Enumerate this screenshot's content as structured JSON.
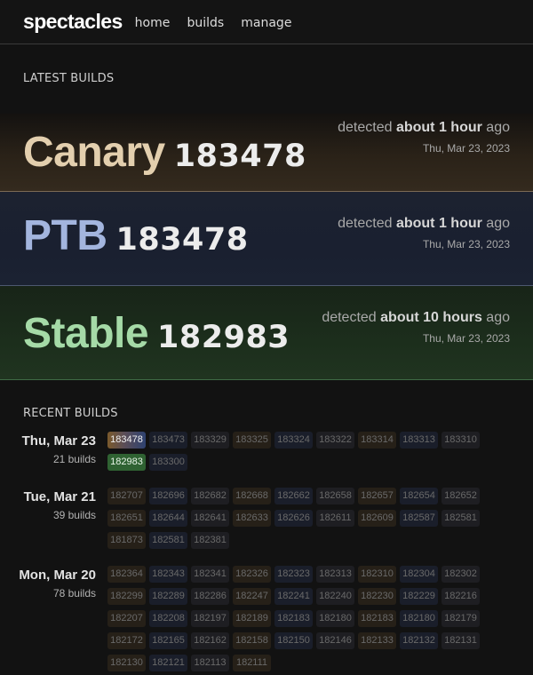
{
  "header": {
    "logo": "spectacles",
    "nav": [
      "home",
      "builds",
      "manage"
    ]
  },
  "latest": {
    "title": "LATEST BUILDS",
    "rows": [
      {
        "channel": "Canary",
        "build": "183478",
        "detected_prefix": "detected",
        "detected_strong": "about 1 hour",
        "detected_suffix": "ago",
        "date": "Thu, Mar 23, 2023",
        "color": "#e3cfae"
      },
      {
        "channel": "PTB",
        "build": "183478",
        "detected_prefix": "detected",
        "detected_strong": "about 1 hour",
        "detected_suffix": "ago",
        "date": "Thu, Mar 23, 2023",
        "color": "#a3b5de"
      },
      {
        "channel": "Stable",
        "build": "182983",
        "detected_prefix": "detected",
        "detected_strong": "about 10 hours",
        "detected_suffix": "ago",
        "date": "Thu, Mar 23, 2023",
        "color": "#a5daa7"
      }
    ]
  },
  "recent": {
    "title": "RECENT BUILDS",
    "groups": [
      {
        "date": "Thu, Mar 23",
        "count": "21 builds",
        "builds": [
          "183478",
          "183473",
          "183329",
          "183325",
          "183324",
          "183322",
          "183314",
          "183313",
          "183310",
          "182983",
          "183300"
        ]
      },
      {
        "date": "Tue, Mar 21",
        "count": "39 builds",
        "builds": [
          "182707",
          "182696",
          "182682",
          "182668",
          "182662",
          "182658",
          "182657",
          "182654",
          "182652",
          "182651",
          "182644",
          "182641",
          "182633",
          "182626",
          "182611",
          "182609",
          "182587",
          "182581",
          "181873",
          "182581",
          "182381"
        ]
      },
      {
        "date": "Mon, Mar 20",
        "count": "78 builds",
        "builds": [
          "182364",
          "182343",
          "182341",
          "182326",
          "182323",
          "182313",
          "182310",
          "182304",
          "182302",
          "182299",
          "182289",
          "182286",
          "182247",
          "182241",
          "182240",
          "182230",
          "182229",
          "182216",
          "182207",
          "182208",
          "182197",
          "182189",
          "182183",
          "182180",
          "182183",
          "182180",
          "182179",
          "182172",
          "182165",
          "182162",
          "182158",
          "182150",
          "182146",
          "182133",
          "182132",
          "182131",
          "182130",
          "182121",
          "182113",
          "182111"
        ]
      }
    ]
  }
}
